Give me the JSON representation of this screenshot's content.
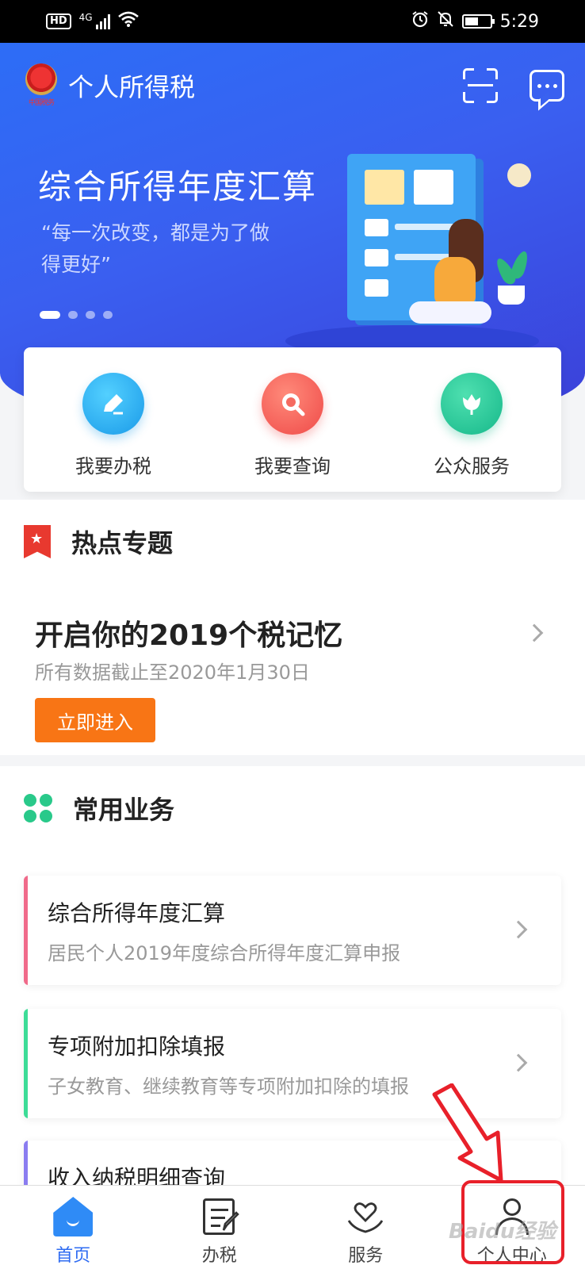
{
  "status_bar": {
    "hd": "HD",
    "network": "4G",
    "time": "5:29"
  },
  "header": {
    "app_title": "个人所得税",
    "emblem_text": "中国税务",
    "scan_icon": "scan-icon",
    "message_icon": "message-icon"
  },
  "banner": {
    "title": "综合所得年度汇算",
    "quote": "“每一次改变，都是为了做得更好”",
    "slide_count": 4,
    "active_slide": 1
  },
  "quick_actions": [
    {
      "label": "我要办税",
      "icon": "pen-icon",
      "color": "#1a9ae8"
    },
    {
      "label": "我要查询",
      "icon": "search-icon",
      "color": "#ef4a48"
    },
    {
      "label": "公众服务",
      "icon": "flower-icon",
      "color": "#16b88a"
    }
  ],
  "hot_topics": {
    "section_title": "热点专题",
    "title": "开启你的2019个税记忆",
    "subtitle": "所有数据截止至2020年1月30日",
    "button": "立即进入",
    "button_color": "#f87515"
  },
  "common": {
    "section_title": "常用业务",
    "items": [
      {
        "title": "综合所得年度汇算",
        "subtitle": "居民个人2019年度综合所得年度汇算申报",
        "accent": "#f06a8a"
      },
      {
        "title": "专项附加扣除填报",
        "subtitle": "子女教育、继续教育等专项附加扣除的填报",
        "accent": "#3ddc97"
      },
      {
        "title": "收入纳税明细查询",
        "subtitle": "",
        "accent": "#8a7cf0"
      }
    ]
  },
  "bottom_nav": [
    {
      "label": "首页",
      "icon": "home-icon",
      "active": true
    },
    {
      "label": "办税",
      "icon": "edit-doc-icon",
      "active": false
    },
    {
      "label": "服务",
      "icon": "heart-hands-icon",
      "active": false
    },
    {
      "label": "个人中心",
      "icon": "person-icon",
      "active": false
    }
  ],
  "annotation": {
    "watermark": "Baidu经验",
    "highlight_color": "#e8202a"
  },
  "colors": {
    "primary": "#2f6cf2",
    "hero_start": "#2d6df6",
    "hero_end": "#3b3fd8"
  }
}
